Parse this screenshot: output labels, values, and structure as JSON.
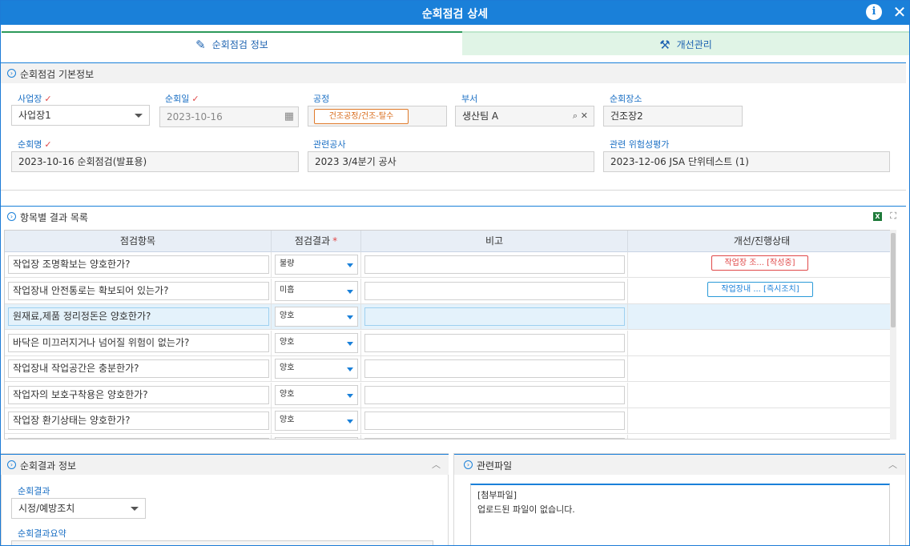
{
  "window": {
    "title": "순회점검 상세"
  },
  "tabs": [
    {
      "label": "순회점검 정보",
      "icon": "pencil-icon"
    },
    {
      "label": "개선관리",
      "icon": "tools-icon"
    }
  ],
  "basic_info": {
    "section_title": "순회점검 기본정보",
    "site": {
      "label": "사업장",
      "value": "사업장1"
    },
    "date": {
      "label": "순회일",
      "value": "2023-10-16"
    },
    "process": {
      "label": "공정",
      "value": "건조공정/건조-탈수"
    },
    "department": {
      "label": "부서",
      "value": "생산팀 A"
    },
    "place": {
      "label": "순회장소",
      "value": "건조장2"
    },
    "name": {
      "label": "순회명",
      "value": "2023-10-16 순회점검(발표용)"
    },
    "construction": {
      "label": "관련공사",
      "value": "2023 3/4분기 공사"
    },
    "risk": {
      "label": "관련 위험성평가",
      "value": "2023-12-06 JSA 단위테스트 (1)"
    }
  },
  "results": {
    "section_title": "항목별 결과 목록",
    "columns": [
      "점검항목",
      "점검결과",
      "비고",
      "개선/진행상태"
    ],
    "rows": [
      {
        "item": "작업장 조명확보는 양호한가?",
        "result": "불량",
        "note": "",
        "status": "작업장 조... [작성중]",
        "status_color": "red"
      },
      {
        "item": "작업장내 안전통로는 확보되어 있는가?",
        "result": "미흡",
        "note": "",
        "status": "작업장내 ... [즉시조치]",
        "status_color": "blue"
      },
      {
        "item": "원재료,제품 정리정돈은 양호한가?",
        "result": "양호",
        "note": "",
        "status": "",
        "status_color": ""
      },
      {
        "item": "바닥은 미끄러지거나 넘어질 위험이 없는가?",
        "result": "양호",
        "note": "",
        "status": "",
        "status_color": ""
      },
      {
        "item": "작업장내 작업공간은 충분한가?",
        "result": "양호",
        "note": "",
        "status": "",
        "status_color": ""
      },
      {
        "item": "작업자의 보호구착용은 양호한가?",
        "result": "양호",
        "note": "",
        "status": "",
        "status_color": ""
      },
      {
        "item": "작업장 환기상태는 양호한가?",
        "result": "양호",
        "note": "",
        "status": "",
        "status_color": ""
      }
    ]
  },
  "summary": {
    "section_title": "순회결과 정보",
    "result_label": "순회결과",
    "result_value": "시정/예방조치",
    "summary_label": "순회결과요약"
  },
  "files": {
    "section_title": "관련파일",
    "box_title": "[첨부파일]",
    "empty_message": "업로드된 파일이 없습니다."
  },
  "colors": {
    "primary": "#1a80d9",
    "tab_inactive_bg": "#e0f4e6",
    "required": "#e04848",
    "tag_orange": "#d86b1a"
  }
}
